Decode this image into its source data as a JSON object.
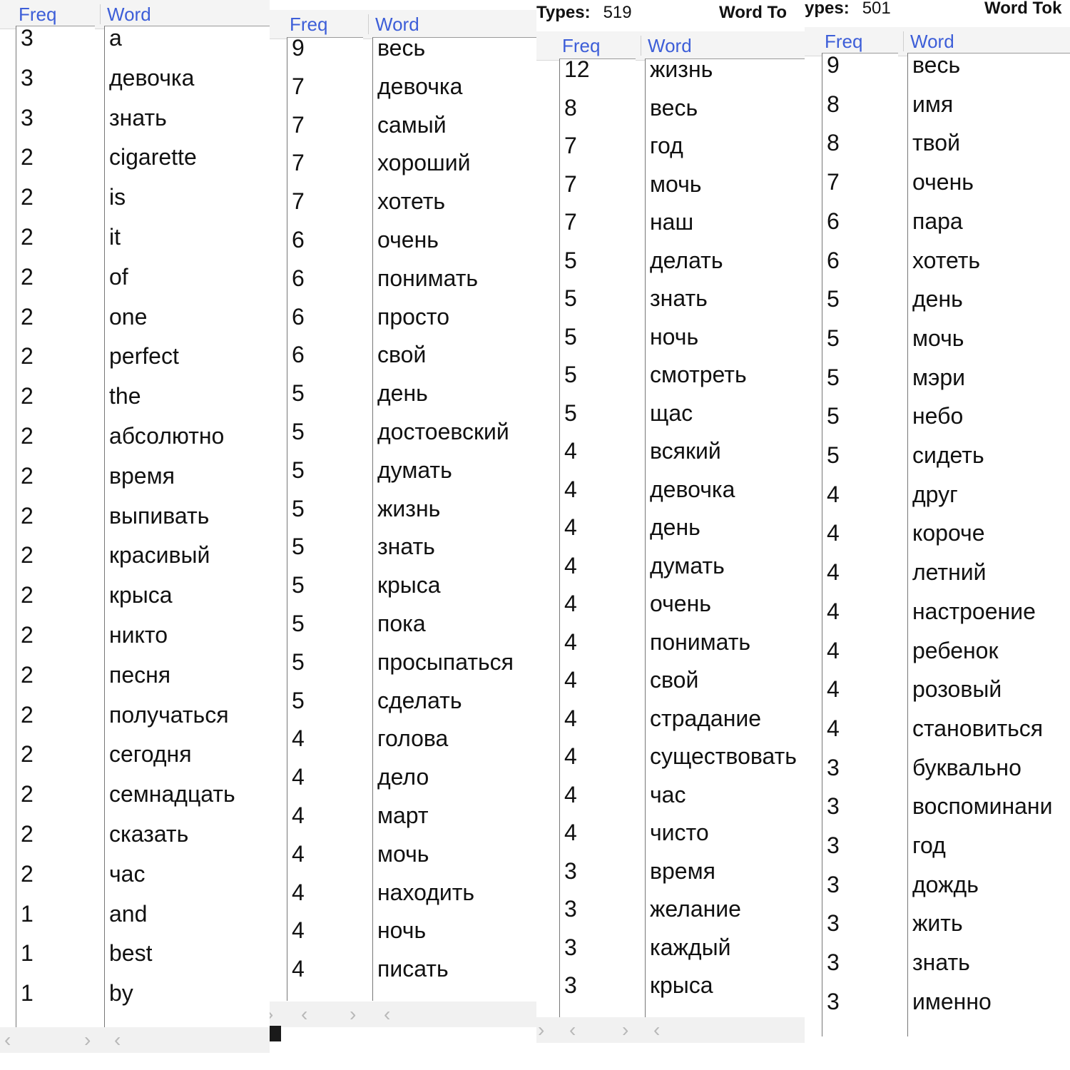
{
  "panels": [
    {
      "types_label": "",
      "types_value": "",
      "tokens_label": "",
      "freq_header": "Freq",
      "word_header": "Word",
      "rows": [
        {
          "freq": "3",
          "word": "a"
        },
        {
          "freq": "3",
          "word": "девочка"
        },
        {
          "freq": "3",
          "word": "знать"
        },
        {
          "freq": "2",
          "word": "cigarette"
        },
        {
          "freq": "2",
          "word": "is"
        },
        {
          "freq": "2",
          "word": "it"
        },
        {
          "freq": "2",
          "word": "of"
        },
        {
          "freq": "2",
          "word": "one"
        },
        {
          "freq": "2",
          "word": "perfect"
        },
        {
          "freq": "2",
          "word": "the"
        },
        {
          "freq": "2",
          "word": "абсолютно"
        },
        {
          "freq": "2",
          "word": "время"
        },
        {
          "freq": "2",
          "word": "выпивать"
        },
        {
          "freq": "2",
          "word": "красивый"
        },
        {
          "freq": "2",
          "word": "крыса"
        },
        {
          "freq": "2",
          "word": "никто"
        },
        {
          "freq": "2",
          "word": "песня"
        },
        {
          "freq": "2",
          "word": "получаться"
        },
        {
          "freq": "2",
          "word": "сегодня"
        },
        {
          "freq": "2",
          "word": "семнадцать"
        },
        {
          "freq": "2",
          "word": "сказать"
        },
        {
          "freq": "2",
          "word": "час"
        },
        {
          "freq": "1",
          "word": "and"
        },
        {
          "freq": "1",
          "word": "best"
        },
        {
          "freq": "1",
          "word": "by"
        }
      ]
    },
    {
      "types_label": "",
      "types_value": "",
      "tokens_label": "",
      "freq_header": "Freq",
      "word_header": "Word",
      "rows": [
        {
          "freq": "9",
          "word": "весь"
        },
        {
          "freq": "7",
          "word": "девочка"
        },
        {
          "freq": "7",
          "word": "самый"
        },
        {
          "freq": "7",
          "word": "хороший"
        },
        {
          "freq": "7",
          "word": "хотеть"
        },
        {
          "freq": "6",
          "word": "очень"
        },
        {
          "freq": "6",
          "word": "понимать"
        },
        {
          "freq": "6",
          "word": "просто"
        },
        {
          "freq": "6",
          "word": "свой"
        },
        {
          "freq": "5",
          "word": "день"
        },
        {
          "freq": "5",
          "word": "достоевский"
        },
        {
          "freq": "5",
          "word": "думать"
        },
        {
          "freq": "5",
          "word": "жизнь"
        },
        {
          "freq": "5",
          "word": "знать"
        },
        {
          "freq": "5",
          "word": "крыса"
        },
        {
          "freq": "5",
          "word": "пока"
        },
        {
          "freq": "5",
          "word": "просыпаться"
        },
        {
          "freq": "5",
          "word": "сделать"
        },
        {
          "freq": "4",
          "word": "голова"
        },
        {
          "freq": "4",
          "word": "дело"
        },
        {
          "freq": "4",
          "word": "март"
        },
        {
          "freq": "4",
          "word": "мочь"
        },
        {
          "freq": "4",
          "word": "находить"
        },
        {
          "freq": "4",
          "word": "ночь"
        },
        {
          "freq": "4",
          "word": "писать"
        }
      ]
    },
    {
      "types_label": "Types:",
      "types_value": "519",
      "tokens_label": "Word To",
      "freq_header": "Freq",
      "word_header": "Word",
      "rows": [
        {
          "freq": "12",
          "word": "жизнь"
        },
        {
          "freq": "8",
          "word": "весь"
        },
        {
          "freq": "7",
          "word": "год"
        },
        {
          "freq": "7",
          "word": "мочь"
        },
        {
          "freq": "7",
          "word": "наш"
        },
        {
          "freq": "5",
          "word": "делать"
        },
        {
          "freq": "5",
          "word": "знать"
        },
        {
          "freq": "5",
          "word": "ночь"
        },
        {
          "freq": "5",
          "word": "смотреть"
        },
        {
          "freq": "5",
          "word": "щас"
        },
        {
          "freq": "4",
          "word": "всякий"
        },
        {
          "freq": "4",
          "word": "девочка"
        },
        {
          "freq": "4",
          "word": "день"
        },
        {
          "freq": "4",
          "word": "думать"
        },
        {
          "freq": "4",
          "word": "очень"
        },
        {
          "freq": "4",
          "word": "понимать"
        },
        {
          "freq": "4",
          "word": "свой"
        },
        {
          "freq": "4",
          "word": "страдание"
        },
        {
          "freq": "4",
          "word": "существовать"
        },
        {
          "freq": "4",
          "word": "час"
        },
        {
          "freq": "4",
          "word": "чисто"
        },
        {
          "freq": "3",
          "word": "время"
        },
        {
          "freq": "3",
          "word": "желание"
        },
        {
          "freq": "3",
          "word": "каждый"
        },
        {
          "freq": "3",
          "word": "крыса"
        }
      ]
    },
    {
      "types_label": "ypes:",
      "types_value": "501",
      "tokens_label": "Word Tok",
      "freq_header": "Freq",
      "word_header": "Word",
      "rows": [
        {
          "freq": "9",
          "word": "весь"
        },
        {
          "freq": "8",
          "word": "имя"
        },
        {
          "freq": "8",
          "word": "твой"
        },
        {
          "freq": "7",
          "word": "очень"
        },
        {
          "freq": "6",
          "word": "пара"
        },
        {
          "freq": "6",
          "word": "хотеть"
        },
        {
          "freq": "5",
          "word": "день"
        },
        {
          "freq": "5",
          "word": "мочь"
        },
        {
          "freq": "5",
          "word": "мэри"
        },
        {
          "freq": "5",
          "word": "небо"
        },
        {
          "freq": "5",
          "word": "сидеть"
        },
        {
          "freq": "4",
          "word": "друг"
        },
        {
          "freq": "4",
          "word": "короче"
        },
        {
          "freq": "4",
          "word": "летний"
        },
        {
          "freq": "4",
          "word": "настроение"
        },
        {
          "freq": "4",
          "word": "ребенок"
        },
        {
          "freq": "4",
          "word": "розовый"
        },
        {
          "freq": "4",
          "word": "становиться"
        },
        {
          "freq": "3",
          "word": "буквально"
        },
        {
          "freq": "3",
          "word": "воспоминани"
        },
        {
          "freq": "3",
          "word": "год"
        },
        {
          "freq": "3",
          "word": "дождь"
        },
        {
          "freq": "3",
          "word": "жить"
        },
        {
          "freq": "3",
          "word": "знать"
        },
        {
          "freq": "3",
          "word": "именно"
        }
      ]
    }
  ],
  "scroll_icons": {
    "left": "‹",
    "right": "›"
  }
}
